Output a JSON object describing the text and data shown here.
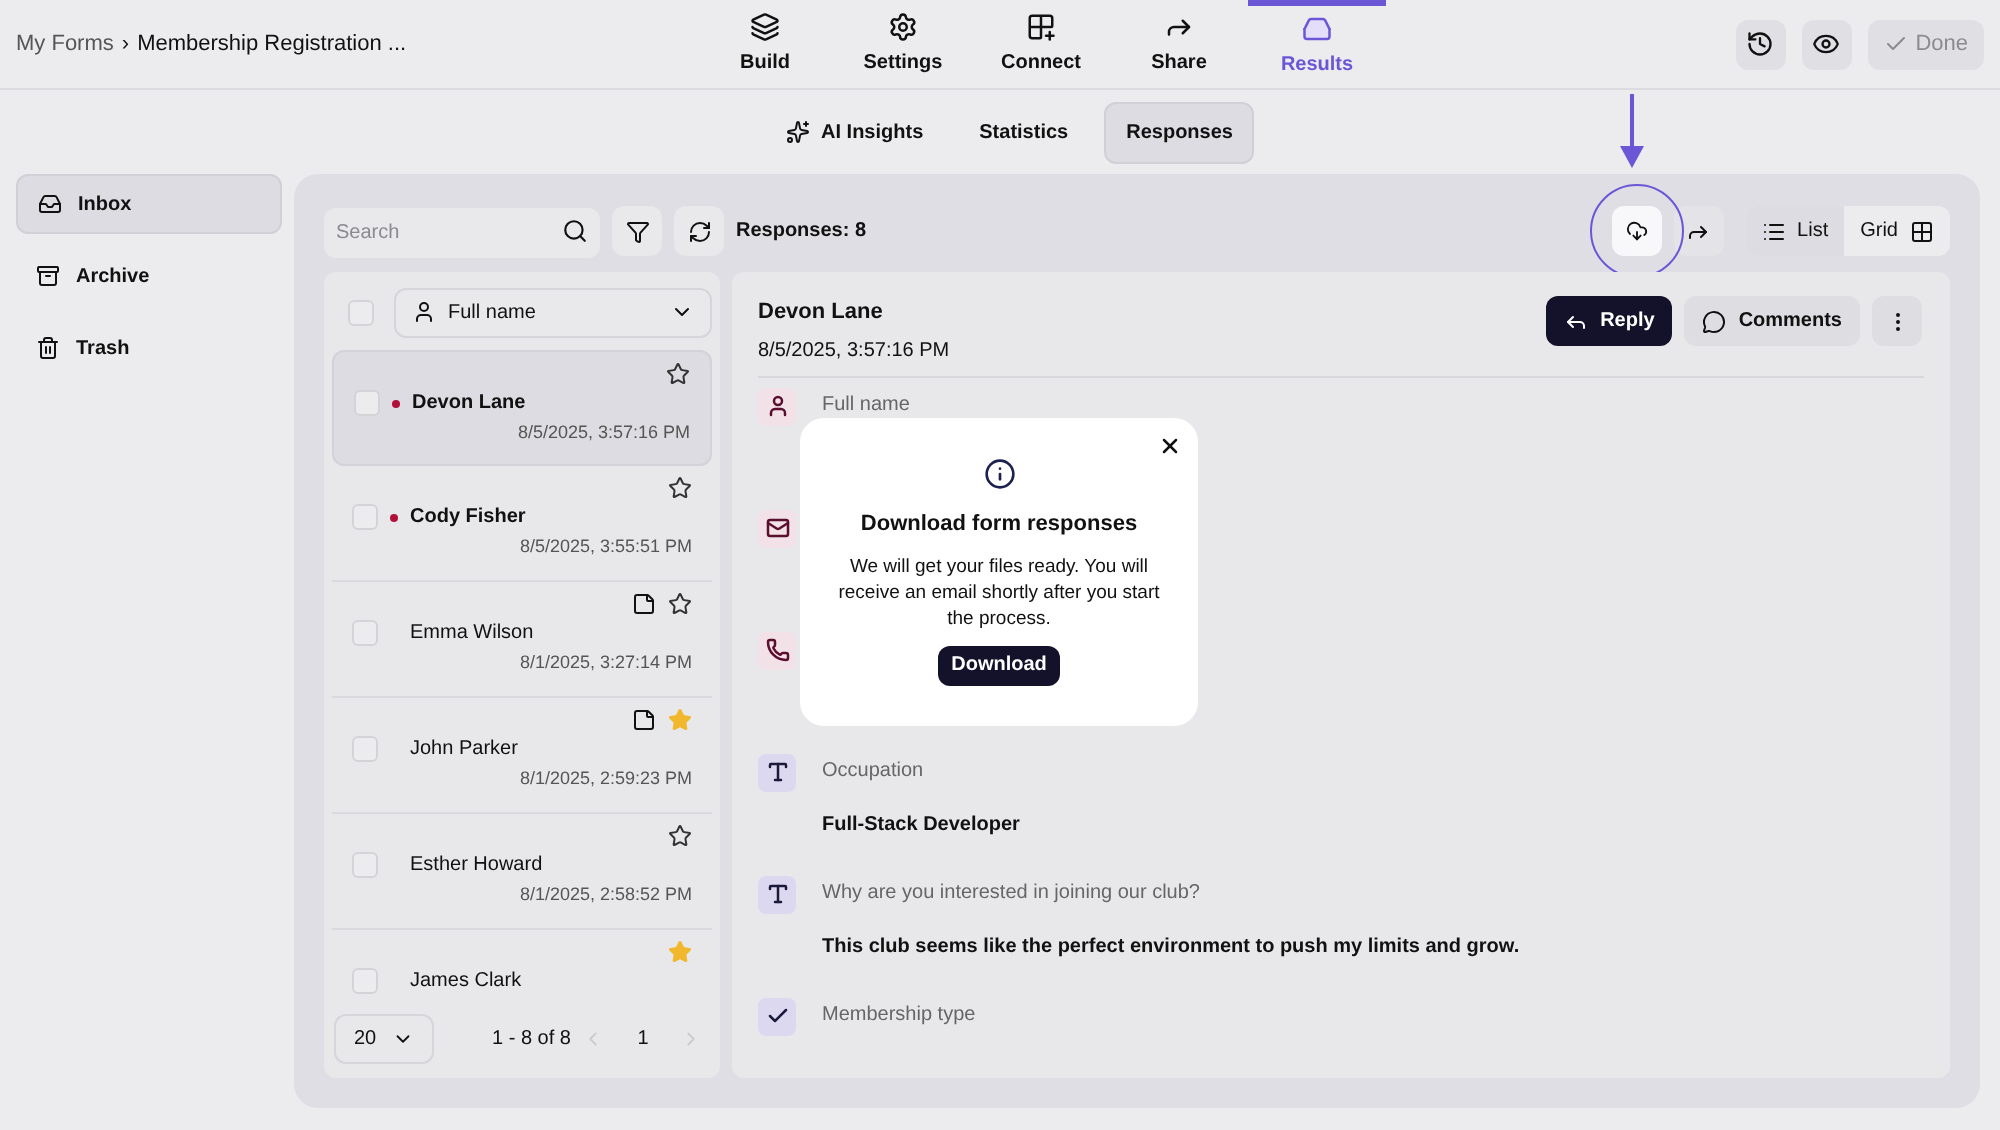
{
  "breadcrumb": {
    "root": "My Forms",
    "separator": "›",
    "current": "Membership Registration ..."
  },
  "nav_tabs": [
    {
      "label": "Build",
      "selected": false
    },
    {
      "label": "Settings",
      "selected": false
    },
    {
      "label": "Connect",
      "selected": false
    },
    {
      "label": "Share",
      "selected": false
    },
    {
      "label": "Results",
      "selected": true
    }
  ],
  "header_actions": {
    "done": "Done"
  },
  "sub_tabs": [
    {
      "label": "AI Insights",
      "selected": false
    },
    {
      "label": "Statistics",
      "selected": false
    },
    {
      "label": "Responses",
      "selected": true
    }
  ],
  "sidebar": {
    "items": [
      {
        "label": "Inbox",
        "selected": true
      },
      {
        "label": "Archive",
        "selected": false
      },
      {
        "label": "Trash",
        "selected": false
      }
    ]
  },
  "toolbar": {
    "search_placeholder": "Search",
    "responses_count": "Responses: 8",
    "views": [
      {
        "label": "List",
        "selected": true
      },
      {
        "label": "Grid",
        "selected": false
      }
    ]
  },
  "list": {
    "sort_field": "Full name",
    "select_all_checked": false,
    "rows": [
      {
        "name": "Devon Lane",
        "date": "8/5/2025, 3:57:16 PM",
        "selected": true,
        "unread": true,
        "has_note": false,
        "starred": false,
        "checked": false
      },
      {
        "name": "Cody Fisher",
        "date": "8/5/2025, 3:55:51 PM",
        "selected": false,
        "unread": true,
        "has_note": false,
        "starred": false,
        "checked": false
      },
      {
        "name": "Emma Wilson",
        "date": "8/1/2025, 3:27:14 PM",
        "selected": false,
        "unread": false,
        "has_note": true,
        "starred": false,
        "checked": false
      },
      {
        "name": "John Parker",
        "date": "8/1/2025, 2:59:23 PM",
        "selected": false,
        "unread": false,
        "has_note": true,
        "starred": true,
        "checked": false
      },
      {
        "name": "Esther Howard",
        "date": "8/1/2025, 2:58:52 PM",
        "selected": false,
        "unread": false,
        "has_note": false,
        "starred": false,
        "checked": false
      },
      {
        "name": "James Clark",
        "selected": false,
        "unread": false,
        "has_note": false,
        "starred": true,
        "checked": false
      }
    ],
    "page_size": "20",
    "range": "1 - 8 of 8",
    "page": "1"
  },
  "detail": {
    "name": "Devon Lane",
    "date": "8/5/2025, 3:57:16 PM",
    "reply": "Reply",
    "comments": "Comments",
    "fields": [
      {
        "kind": "person",
        "label": "Full name"
      },
      {
        "kind": "email"
      },
      {
        "kind": "phone"
      },
      {
        "kind": "text",
        "label": "Occupation",
        "value": "Full-Stack Developer"
      },
      {
        "kind": "text",
        "label": "Why are you interested in joining our club?",
        "value": "This club seems like the perfect environment to push my limits and grow."
      },
      {
        "kind": "choice",
        "label": "Membership type"
      }
    ]
  },
  "dialog": {
    "title": "Download form responses",
    "message": "We will get your files ready. You will receive an email shortly after you start the process.",
    "button": "Download"
  }
}
